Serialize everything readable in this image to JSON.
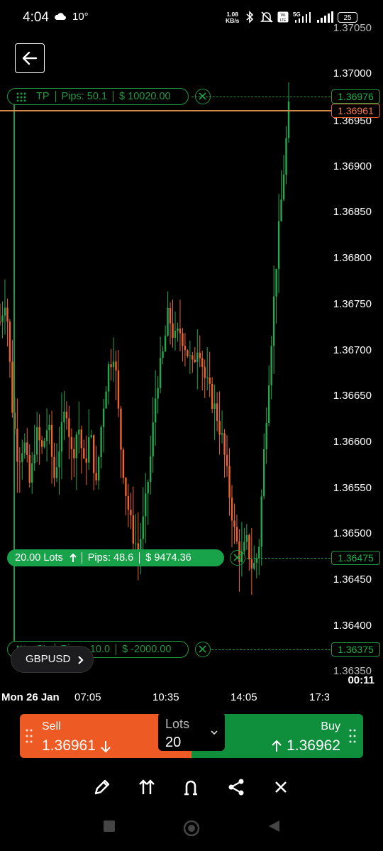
{
  "status_bar": {
    "time": "4:04",
    "temperature": "10°",
    "network_speed": "1.08",
    "network_unit": "KB/s",
    "battery": "25"
  },
  "price_axis": [
    "1.37050",
    "1.37000",
    "1.36950",
    "1.36900",
    "1.36850",
    "1.36800",
    "1.36750",
    "1.36700",
    "1.36650",
    "1.36600",
    "1.36550",
    "1.36500",
    "1.36450",
    "1.36400",
    "1.36350"
  ],
  "time_axis": [
    "Mon 26 Jan",
    "07:05",
    "10:35",
    "14:05",
    "17:3"
  ],
  "take_profit": {
    "label": "TP",
    "pips": "Pips: 50.1",
    "amount": "$ 10020.00",
    "price": "1.36976"
  },
  "current_price_tag": "1.36961",
  "position": {
    "lots": "20.00 Lots",
    "pips": "Pips: 48.6",
    "amount": "$ 9474.36",
    "price": "1.36475"
  },
  "stop_loss": {
    "label": "SL",
    "pips": "Pips: -10.0",
    "amount": "$ -2000.00",
    "price": "1.36375"
  },
  "symbol": "GBPUSD",
  "candle_timer": "00:11",
  "trade": {
    "sell_label": "Sell",
    "sell_price": "1.36961",
    "lots_label": "Lots",
    "lots_value": "20",
    "buy_label": "Buy",
    "buy_price": "1.36962"
  },
  "colors": {
    "up": "#22a84d",
    "down": "#f0642a",
    "accent_orange": "#e8a35a",
    "sell_bg": "#ee5a24",
    "buy_bg": "#0f8f3c"
  },
  "icons": [
    "back-arrow-icon",
    "drag-handle-icon",
    "close-circle-icon",
    "arrow-up-icon",
    "chevron-right-icon",
    "chevron-down-icon",
    "arrow-down-icon",
    "pencil-icon",
    "double-arrow-up-icon",
    "magnet-icon",
    "share-icon",
    "close-icon"
  ],
  "chart_data": {
    "type": "candlestick",
    "ylim": [
      1.3635,
      1.3705
    ],
    "x": [
      "Mon 26 Jan",
      "07:05",
      "10:35",
      "14:05",
      "17:3"
    ],
    "levels": {
      "take_profit": 1.36976,
      "current": 1.36961,
      "entry": 1.36475,
      "stop_loss": 1.36375
    },
    "close_path": [
      1.3673,
      1.3676,
      1.3664,
      1.3658,
      1.366,
      1.3655,
      1.3661,
      1.3659,
      1.3662,
      1.3656,
      1.366,
      1.3664,
      1.3658,
      1.3662,
      1.3657,
      1.3661,
      1.3655,
      1.3663,
      1.3668,
      1.367,
      1.366,
      1.3654,
      1.365,
      1.3648,
      1.3652,
      1.3658,
      1.3666,
      1.3669,
      1.3674,
      1.3671,
      1.3672,
      1.367,
      1.3668,
      1.3671,
      1.3667,
      1.3665,
      1.3663,
      1.366,
      1.3655,
      1.365,
      1.3647,
      1.3649,
      1.3646,
      1.3648,
      1.366,
      1.367,
      1.368,
      1.3688,
      1.3696
    ]
  }
}
